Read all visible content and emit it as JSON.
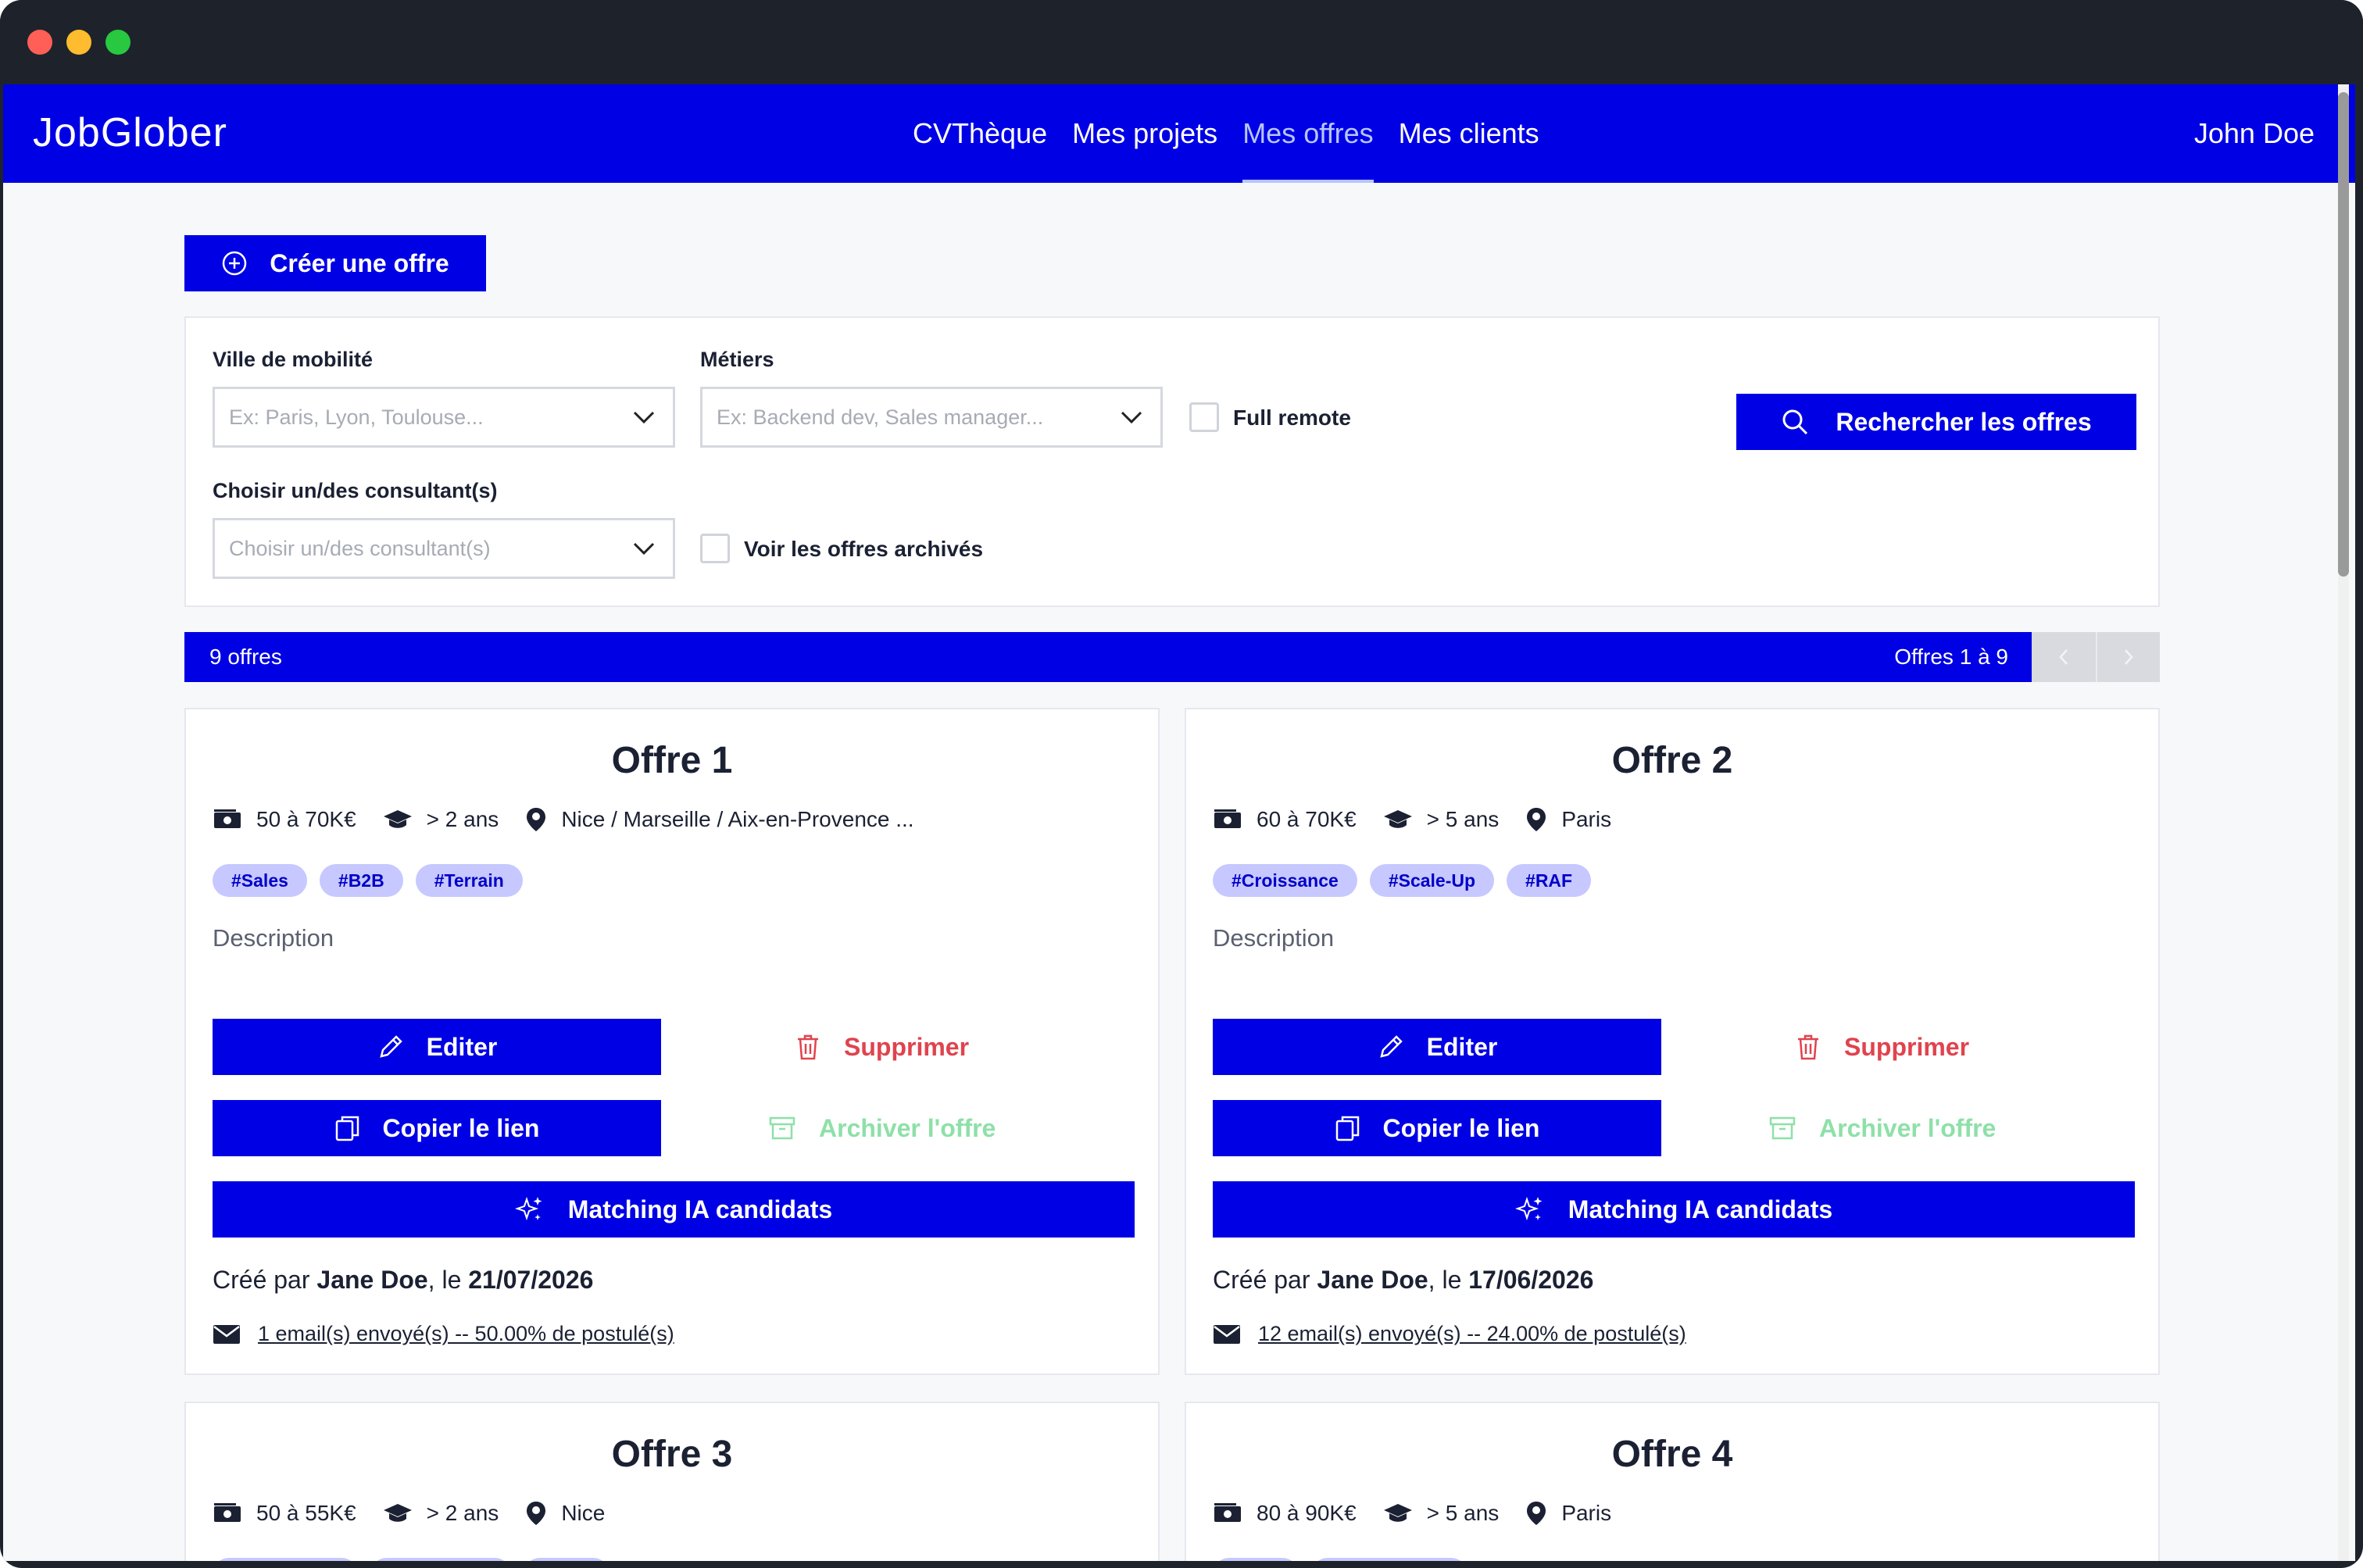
{
  "header": {
    "logo": "JobGlober",
    "nav": [
      "CVThèque",
      "Mes projets",
      "Mes offres",
      "Mes clients"
    ],
    "active_nav": "Mes offres",
    "user": "John Doe"
  },
  "create_button": "Créer une offre",
  "filters": {
    "city_label": "Ville de mobilité",
    "city_placeholder": "Ex: Paris, Lyon, Toulouse...",
    "jobs_label": "Métiers",
    "jobs_placeholder": "Ex: Backend dev, Sales manager...",
    "remote_label": "Full remote",
    "consultant_label": "Choisir un/des consultant(s)",
    "consultant_placeholder": "Choisir un/des consultant(s)",
    "archived_label": "Voir les offres archivés",
    "search_button": "Rechercher les offres"
  },
  "results": {
    "count": "9 offres",
    "range": "Offres 1 à 9"
  },
  "offers": [
    {
      "title": "Offre 1",
      "salary": "50 à 70K€",
      "experience": "> 2 ans",
      "location": "Nice / Marseille / Aix-en-Provence ...",
      "tags": [
        "#Sales",
        "#B2B",
        "#Terrain"
      ],
      "description": "Description",
      "edit": "Editer",
      "delete": "Supprimer",
      "copy": "Copier le lien",
      "archive": "Archiver l'offre",
      "match": "Matching IA candidats",
      "created_prefix": "Créé par",
      "author": "Jane Doe",
      "created_mid": ", le",
      "date": "21/07/2026",
      "emails": "1 email(s) envoyé(s) -- 50.00% de postulé(s)"
    },
    {
      "title": "Offre 2",
      "salary": "60 à 70K€",
      "experience": "> 5 ans",
      "location": "Paris",
      "tags": [
        "#Croissance",
        "#Scale-Up",
        "#RAF"
      ],
      "description": "Description",
      "edit": "Editer",
      "delete": "Supprimer",
      "copy": "Copier le lien",
      "archive": "Archiver l'offre",
      "match": "Matching IA candidats",
      "created_prefix": "Créé par",
      "author": "Jane Doe",
      "created_mid": ", le",
      "date": "17/06/2026",
      "emails": "12 email(s) envoyé(s) -- 24.00% de postulé(s)"
    },
    {
      "title": "Offre 3",
      "salary": "50 à 55K€",
      "experience": "> 2 ans",
      "location": "Nice"
    },
    {
      "title": "Offre 4",
      "salary": "80 à 90K€",
      "experience": "> 5 ans",
      "location": "Paris"
    }
  ],
  "colors": {
    "primary": "#0000e4",
    "danger": "#e0434e",
    "archive": "#8ee0a8",
    "tag_bg": "#c6c8ff"
  }
}
